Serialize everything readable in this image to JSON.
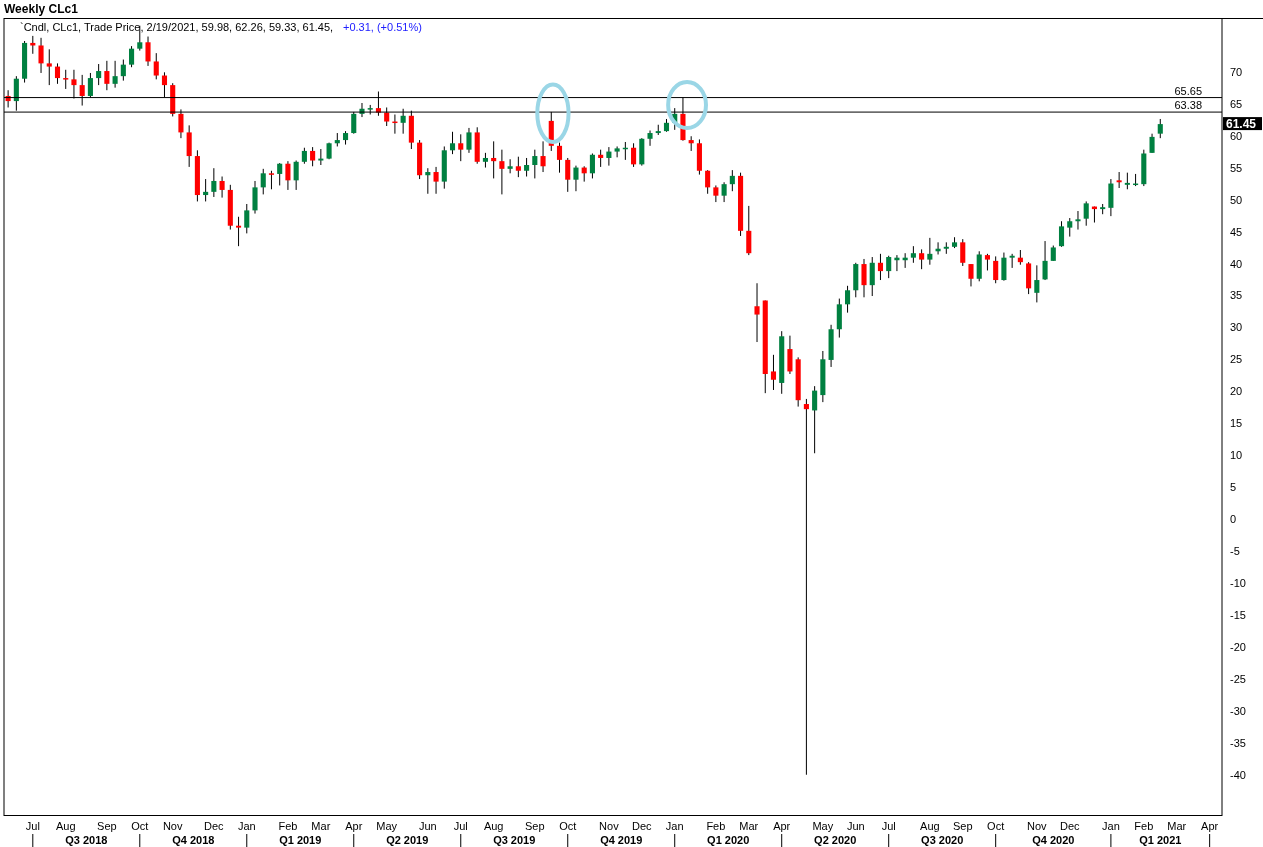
{
  "window": {
    "title": "Weekly CLc1"
  },
  "legend": {
    "text": "`Cndl, CLc1, Trade Price, 2/19/2021, 59.98, 62.26, 59.33, 61.45,",
    "change": "+0.31, (+0.51%)"
  },
  "last_price": {
    "label": "61.45"
  },
  "time_axis": {
    "quarters": [
      "Q3 2018",
      "Q4 2018",
      "Q1 2019",
      "Q2 2019",
      "Q3 2019",
      "Q4 2019",
      "Q1 2020",
      "Q2 2020",
      "Q3 2020",
      "Q4 2020",
      "Q1 2021"
    ]
  },
  "chart_data": {
    "type": "candlestick",
    "ylim": [
      -46.6,
      78.1
    ],
    "yticks": [
      70,
      65,
      60,
      55,
      50,
      45,
      40,
      35,
      30,
      25,
      20,
      15,
      10,
      5,
      0,
      -5,
      -10,
      -15,
      -20,
      -25,
      -30,
      -35,
      -40
    ],
    "ref_lines": [
      {
        "axis": "y",
        "value": 65.65,
        "label": "65.65"
      },
      {
        "axis": "y",
        "value": 63.38,
        "label": "63.38"
      }
    ],
    "categories": [
      null,
      null,
      null,
      "Jul",
      null,
      null,
      null,
      "Aug",
      null,
      null,
      null,
      null,
      "Sep",
      null,
      null,
      null,
      "Oct",
      null,
      null,
      null,
      "Nov",
      null,
      null,
      null,
      null,
      "Dec",
      null,
      null,
      null,
      "Jan",
      null,
      null,
      null,
      null,
      "Feb",
      null,
      null,
      null,
      "Mar",
      null,
      null,
      null,
      "Apr",
      null,
      null,
      null,
      "May",
      null,
      null,
      null,
      null,
      "Jun",
      null,
      null,
      null,
      "Jul",
      null,
      null,
      null,
      "Aug",
      null,
      null,
      null,
      null,
      "Sep",
      null,
      null,
      null,
      "Oct",
      null,
      null,
      null,
      null,
      "Nov",
      null,
      null,
      null,
      "Dec",
      null,
      null,
      null,
      "Jan",
      null,
      null,
      null,
      null,
      "Feb",
      null,
      null,
      null,
      "Mar",
      null,
      null,
      null,
      "Apr",
      null,
      null,
      null,
      null,
      "May",
      null,
      null,
      null,
      "Jun",
      null,
      null,
      null,
      "Jul",
      null,
      null,
      null,
      null,
      "Aug",
      null,
      null,
      null,
      "Sep",
      null,
      null,
      null,
      "Oct",
      null,
      null,
      null,
      null,
      "Nov",
      null,
      null,
      null,
      "Dec",
      null,
      null,
      null,
      null,
      "Jan",
      null,
      null,
      null,
      "Feb",
      null,
      null,
      null,
      "Mar",
      null,
      null,
      null,
      "Apr",
      null
    ],
    "ohlc": [
      [
        65.9,
        66.8,
        64.1,
        65.1
      ],
      [
        65.1,
        69.0,
        63.6,
        68.6
      ],
      [
        68.6,
        74.5,
        68.0,
        74.2
      ],
      [
        74.2,
        75.3,
        72.5,
        73.8
      ],
      [
        73.8,
        75.0,
        69.5,
        71.0
      ],
      [
        71.0,
        73.2,
        67.6,
        70.5
      ],
      [
        70.5,
        71.0,
        67.8,
        68.7
      ],
      [
        68.7,
        70.0,
        67.0,
        68.5
      ],
      [
        68.5,
        70.0,
        65.5,
        67.6
      ],
      [
        67.6,
        69.2,
        64.4,
        65.9
      ],
      [
        65.9,
        69.5,
        65.7,
        68.7
      ],
      [
        68.7,
        70.9,
        67.6,
        69.8
      ],
      [
        69.8,
        71.4,
        66.8,
        67.8
      ],
      [
        67.8,
        71.4,
        67.2,
        69.0
      ],
      [
        69.0,
        71.6,
        68.3,
        70.8
      ],
      [
        70.8,
        73.7,
        70.4,
        73.3
      ],
      [
        73.3,
        76.9,
        73.0,
        74.3
      ],
      [
        74.3,
        75.2,
        70.6,
        71.3
      ],
      [
        71.3,
        72.6,
        68.5,
        69.1
      ],
      [
        69.1,
        69.6,
        65.7,
        67.6
      ],
      [
        67.6,
        67.9,
        62.7,
        63.1
      ],
      [
        63.1,
        63.8,
        59.3,
        60.2
      ],
      [
        60.2,
        61.3,
        54.8,
        56.5
      ],
      [
        56.5,
        57.4,
        49.4,
        50.4
      ],
      [
        50.4,
        52.9,
        49.4,
        50.9
      ],
      [
        50.9,
        54.6,
        50.1,
        52.6
      ],
      [
        52.6,
        53.3,
        50.0,
        51.2
      ],
      [
        51.2,
        52.0,
        45.0,
        45.6
      ],
      [
        45.6,
        47.0,
        42.4,
        45.3
      ],
      [
        45.3,
        49.0,
        44.4,
        48.0
      ],
      [
        48.0,
        52.6,
        47.5,
        51.6
      ],
      [
        51.6,
        54.5,
        50.5,
        53.8
      ],
      [
        53.8,
        54.2,
        51.3,
        53.7
      ],
      [
        53.7,
        55.4,
        51.9,
        55.3
      ],
      [
        55.3,
        55.7,
        51.2,
        52.7
      ],
      [
        52.7,
        55.8,
        51.2,
        55.6
      ],
      [
        55.6,
        57.8,
        55.3,
        57.3
      ],
      [
        57.3,
        57.9,
        54.9,
        55.8
      ],
      [
        55.8,
        57.6,
        55.1,
        56.1
      ],
      [
        56.1,
        58.6,
        56.0,
        58.5
      ],
      [
        58.5,
        60.1,
        58.0,
        59.0
      ],
      [
        59.0,
        60.4,
        58.3,
        60.1
      ],
      [
        60.1,
        63.4,
        60.0,
        63.1
      ],
      [
        63.1,
        64.8,
        62.6,
        63.9
      ],
      [
        63.9,
        64.5,
        63.0,
        64.0
      ],
      [
        64.0,
        66.6,
        62.8,
        63.3
      ],
      [
        63.3,
        64.1,
        61.2,
        61.9
      ],
      [
        61.9,
        63.0,
        60.0,
        61.7
      ],
      [
        61.7,
        63.9,
        60.0,
        62.8
      ],
      [
        62.8,
        63.6,
        57.6,
        58.6
      ],
      [
        58.6,
        59.0,
        52.9,
        53.5
      ],
      [
        53.5,
        54.6,
        50.6,
        54.0
      ],
      [
        54.0,
        54.8,
        50.6,
        52.5
      ],
      [
        52.5,
        58.0,
        51.4,
        57.4
      ],
      [
        57.4,
        60.3,
        56.8,
        58.5
      ],
      [
        58.5,
        59.9,
        55.7,
        57.5
      ],
      [
        57.5,
        60.9,
        57.0,
        60.2
      ],
      [
        60.2,
        61.0,
        55.3,
        55.6
      ],
      [
        55.6,
        57.0,
        54.7,
        56.2
      ],
      [
        56.2,
        58.8,
        53.0,
        55.7
      ],
      [
        55.7,
        57.5,
        50.5,
        54.5
      ],
      [
        54.5,
        56.0,
        53.8,
        54.9
      ],
      [
        54.9,
        56.4,
        53.2,
        54.2
      ],
      [
        54.2,
        56.2,
        53.3,
        55.1
      ],
      [
        55.1,
        57.5,
        53.0,
        56.5
      ],
      [
        56.5,
        58.8,
        54.0,
        54.9
      ],
      [
        62.0,
        63.4,
        57.3,
        58.1
      ],
      [
        58.1,
        58.6,
        53.9,
        55.9
      ],
      [
        55.9,
        56.2,
        50.9,
        52.8
      ],
      [
        52.8,
        55.0,
        51.0,
        54.7
      ],
      [
        54.7,
        54.9,
        52.5,
        53.8
      ],
      [
        53.8,
        56.9,
        53.0,
        56.7
      ],
      [
        56.7,
        57.5,
        54.8,
        56.2
      ],
      [
        56.2,
        57.9,
        55.0,
        57.2
      ],
      [
        57.2,
        58.0,
        56.3,
        57.7
      ],
      [
        57.7,
        58.7,
        55.9,
        57.8
      ],
      [
        57.8,
        58.5,
        54.8,
        55.2
      ],
      [
        55.2,
        59.3,
        55.0,
        59.2
      ],
      [
        59.2,
        60.5,
        58.1,
        60.1
      ],
      [
        60.1,
        61.4,
        59.8,
        60.4
      ],
      [
        60.4,
        62.3,
        60.3,
        61.7
      ],
      [
        61.7,
        64.0,
        60.6,
        63.1
      ],
      [
        63.1,
        65.7,
        58.9,
        59.0
      ],
      [
        59.0,
        59.6,
        57.3,
        58.5
      ],
      [
        58.5,
        59.1,
        53.6,
        54.2
      ],
      [
        54.2,
        54.3,
        50.6,
        51.6
      ],
      [
        51.6,
        51.9,
        49.3,
        50.3
      ],
      [
        50.3,
        52.4,
        49.3,
        52.1
      ],
      [
        52.1,
        54.3,
        51.0,
        53.4
      ],
      [
        53.4,
        53.9,
        44.0,
        44.8
      ],
      [
        44.8,
        48.7,
        41.0,
        41.3
      ],
      [
        33.0,
        36.6,
        27.4,
        31.7
      ],
      [
        33.9,
        33.9,
        19.4,
        22.4
      ],
      [
        22.8,
        25.4,
        19.9,
        21.5
      ],
      [
        21.0,
        29.1,
        19.3,
        28.3
      ],
      [
        26.3,
        28.4,
        22.4,
        22.8
      ],
      [
        24.7,
        25.0,
        17.3,
        18.3
      ],
      [
        17.7,
        18.5,
        -40.3,
        16.9
      ],
      [
        16.7,
        20.5,
        10.0,
        19.8
      ],
      [
        19.1,
        26.0,
        18.0,
        24.7
      ],
      [
        24.6,
        30.1,
        23.5,
        29.4
      ],
      [
        29.4,
        34.2,
        28.1,
        33.3
      ],
      [
        33.3,
        36.2,
        32.0,
        35.5
      ],
      [
        35.5,
        39.8,
        34.4,
        39.6
      ],
      [
        39.6,
        40.4,
        34.4,
        36.3
      ],
      [
        36.3,
        40.7,
        34.6,
        39.8
      ],
      [
        39.8,
        41.2,
        37.1,
        38.5
      ],
      [
        38.5,
        40.9,
        37.4,
        40.7
      ],
      [
        40.2,
        41.0,
        38.5,
        40.6
      ],
      [
        40.2,
        41.3,
        39.0,
        40.6
      ],
      [
        40.6,
        42.4,
        39.8,
        41.3
      ],
      [
        41.3,
        41.9,
        38.8,
        40.3
      ],
      [
        40.3,
        43.7,
        39.5,
        41.2
      ],
      [
        41.6,
        43.0,
        41.1,
        42.0
      ],
      [
        42.0,
        43.0,
        41.2,
        42.3
      ],
      [
        42.3,
        43.8,
        42.1,
        43.0
      ],
      [
        43.0,
        43.5,
        39.3,
        39.8
      ],
      [
        39.6,
        39.6,
        36.1,
        37.3
      ],
      [
        37.3,
        41.6,
        36.9,
        41.1
      ],
      [
        41.0,
        41.2,
        38.6,
        40.3
      ],
      [
        40.1,
        40.8,
        36.6,
        37.1
      ],
      [
        37.1,
        41.4,
        37.0,
        40.6
      ],
      [
        40.6,
        41.2,
        39.0,
        40.9
      ],
      [
        40.6,
        41.8,
        39.5,
        39.9
      ],
      [
        39.7,
        39.9,
        34.9,
        35.8
      ],
      [
        35.1,
        39.4,
        33.6,
        37.1
      ],
      [
        37.2,
        43.2,
        37.1,
        40.1
      ],
      [
        40.1,
        42.5,
        40.1,
        42.2
      ],
      [
        42.4,
        46.3,
        42.3,
        45.5
      ],
      [
        45.3,
        46.8,
        43.9,
        46.3
      ],
      [
        46.3,
        47.9,
        45.0,
        46.6
      ],
      [
        46.7,
        49.4,
        45.6,
        49.1
      ],
      [
        48.6,
        48.6,
        46.1,
        48.2
      ],
      [
        48.2,
        49.0,
        47.4,
        48.5
      ],
      [
        48.4,
        52.9,
        47.1,
        52.2
      ],
      [
        52.7,
        54.0,
        51.5,
        52.4
      ],
      [
        52.0,
        53.9,
        51.3,
        52.3
      ],
      [
        52.1,
        53.7,
        51.8,
        52.2
      ],
      [
        52.1,
        57.5,
        51.8,
        56.9
      ],
      [
        57.0,
        60.0,
        57.0,
        59.5
      ],
      [
        60.0,
        62.3,
        59.3,
        61.5
      ],
      null,
      null,
      null,
      null,
      null,
      null,
      null
    ]
  }
}
